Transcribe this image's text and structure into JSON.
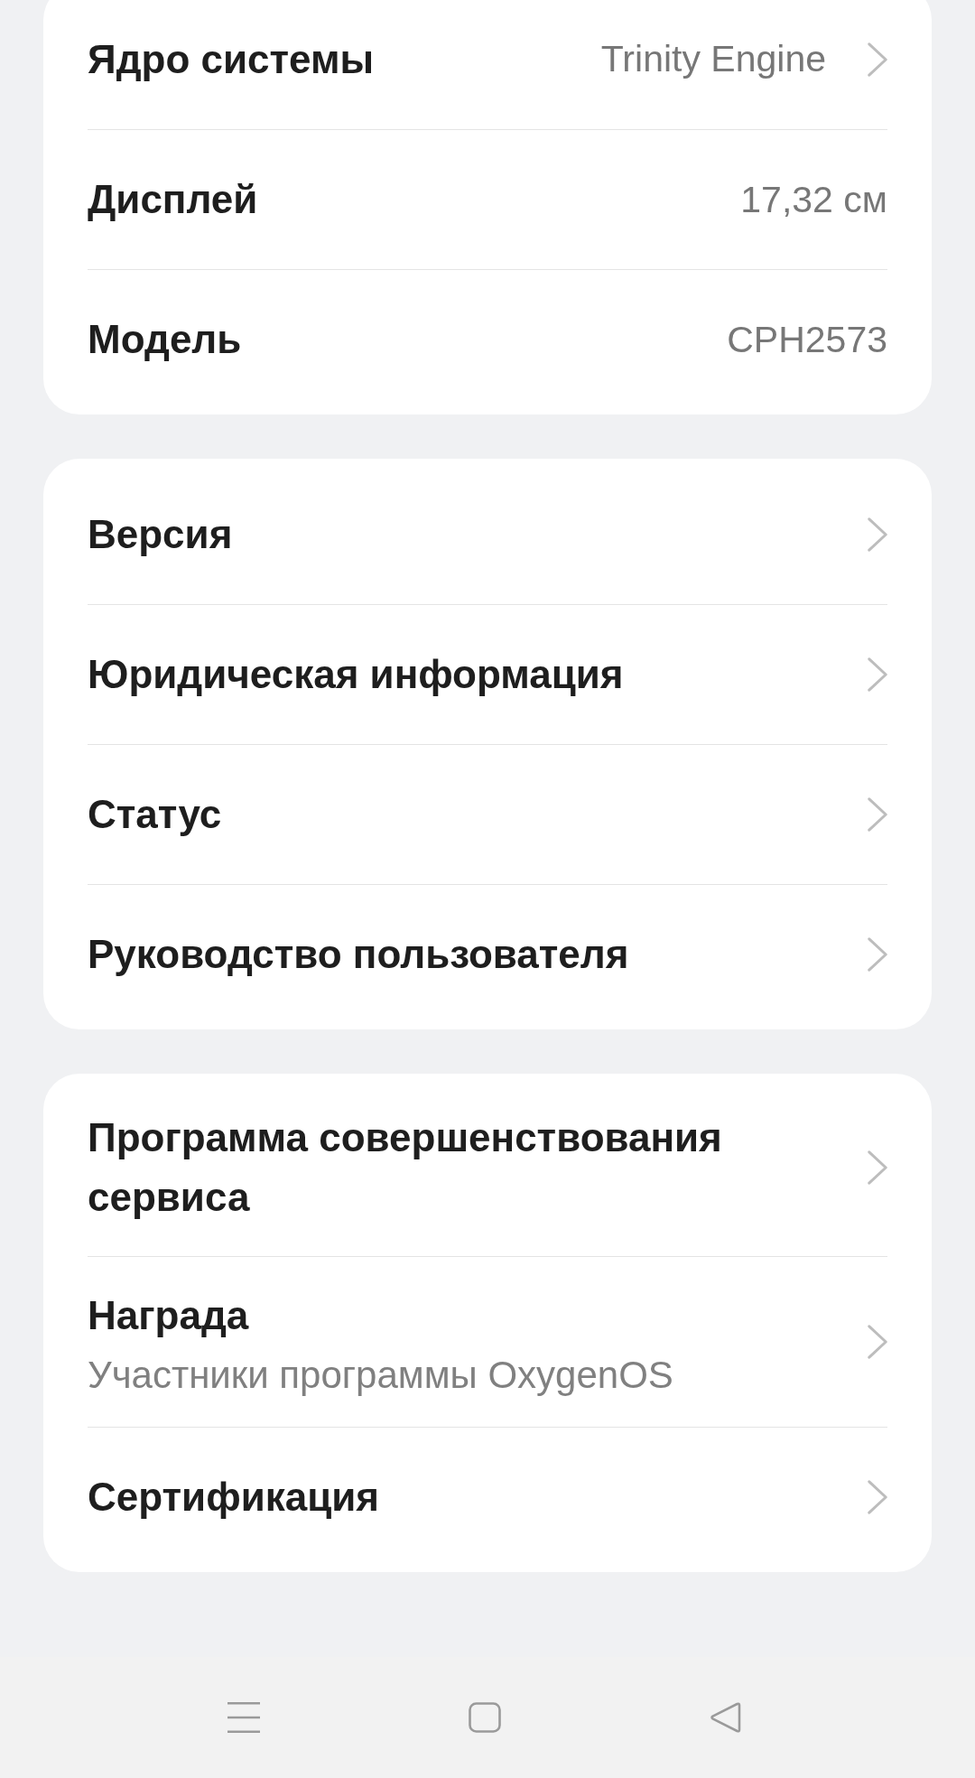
{
  "sections": [
    {
      "items": [
        {
          "title": "Ядро системы",
          "value": "Trinity Engine",
          "chevron": true
        },
        {
          "title": "Дисплей",
          "value": "17,32 см",
          "chevron": false
        },
        {
          "title": "Модель",
          "value": "CPH2573",
          "chevron": false
        }
      ]
    },
    {
      "items": [
        {
          "title": "Версия",
          "chevron": true
        },
        {
          "title": "Юридическая информация",
          "chevron": true
        },
        {
          "title": "Статус",
          "chevron": true
        },
        {
          "title": "Руководство пользователя",
          "chevron": true
        }
      ]
    },
    {
      "items": [
        {
          "title": "Программа совершенствования сервиса",
          "chevron": true
        },
        {
          "title": "Награда",
          "subtitle": "Участники программы OxygenOS",
          "chevron": true
        },
        {
          "title": "Сертификация",
          "chevron": true
        }
      ]
    }
  ],
  "nav_bar": {
    "buttons": [
      {
        "kind": "menu"
      },
      {
        "kind": "home"
      },
      {
        "kind": "back"
      }
    ]
  }
}
